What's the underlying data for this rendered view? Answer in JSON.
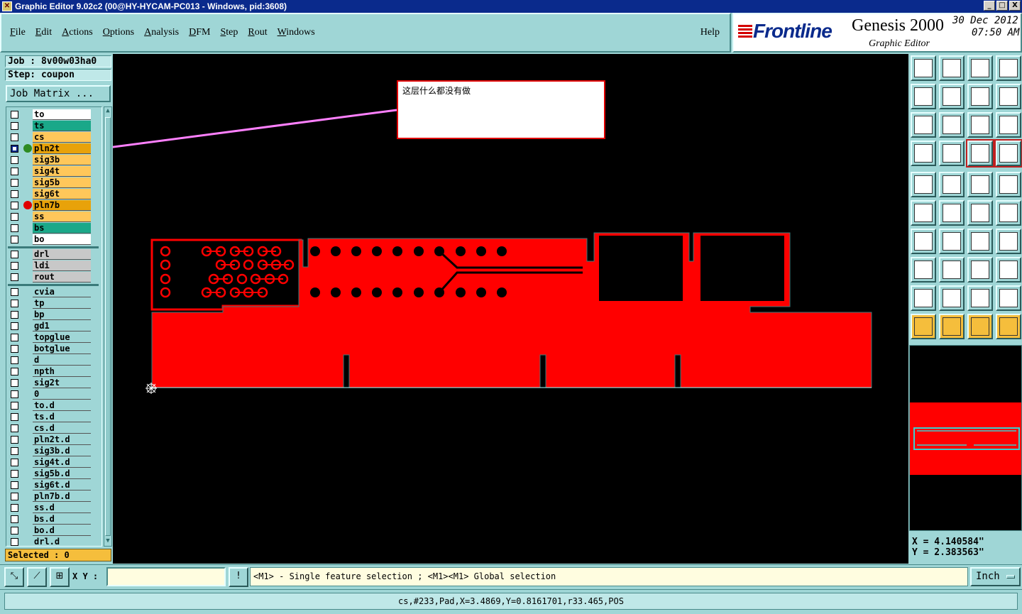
{
  "window": {
    "title": "Graphic Editor 9.02c2 (00@HY-HYCAM-PC013 - Windows, pid:3608)",
    "buttons": [
      "_",
      "□",
      "X"
    ]
  },
  "menu": {
    "items": [
      "File",
      "Edit",
      "Actions",
      "Options",
      "Analysis",
      "DFM",
      "Step",
      "Rout",
      "Windows"
    ],
    "help": "Help"
  },
  "brand": {
    "logo": "Frontline",
    "product": "Genesis 2000",
    "subtitle": "Graphic Editor",
    "date": "30 Dec 2012",
    "time": "07:50 AM"
  },
  "job": {
    "job_label": "Job : 8v00w03ha0",
    "step_label": "Step: coupon",
    "matrix_button": "Job Matrix ..."
  },
  "layers_board": [
    {
      "name": "to",
      "color": "#ffffff"
    },
    {
      "name": "ts",
      "color": "#1aa889"
    },
    {
      "name": "cs",
      "color": "#ffc75a"
    },
    {
      "name": "pln2t",
      "color": "#e8a20a",
      "active": true,
      "dot": "#2e8b22"
    },
    {
      "name": "sig3b",
      "color": "#ffc75a"
    },
    {
      "name": "sig4t",
      "color": "#ffc75a"
    },
    {
      "name": "sig5b",
      "color": "#ffc75a"
    },
    {
      "name": "sig6t",
      "color": "#ffc75a"
    },
    {
      "name": "pln7b",
      "color": "#e8a20a",
      "dot": "#e00000"
    },
    {
      "name": "ss",
      "color": "#ffc75a"
    },
    {
      "name": "bs",
      "color": "#1aa889"
    },
    {
      "name": "bo",
      "color": "#ffffff"
    }
  ],
  "layers_drill": [
    {
      "name": "drl",
      "color": "#c8c8c8"
    },
    {
      "name": "ldi",
      "color": "#c8c8c8"
    },
    {
      "name": "rout",
      "color": "#c8c8c8"
    }
  ],
  "layers_misc": [
    {
      "name": "cvia",
      "color": "#9fd6d6"
    },
    {
      "name": "tp",
      "color": "#9fd6d6"
    },
    {
      "name": "bp",
      "color": "#9fd6d6"
    },
    {
      "name": "gd1",
      "color": "#9fd6d6"
    },
    {
      "name": "topglue",
      "color": "#9fd6d6"
    },
    {
      "name": "botglue",
      "color": "#9fd6d6"
    },
    {
      "name": "d",
      "color": "#9fd6d6"
    },
    {
      "name": "npth",
      "color": "#9fd6d6"
    },
    {
      "name": "sig2t",
      "color": "#9fd6d6"
    },
    {
      "name": "0",
      "color": "#9fd6d6"
    },
    {
      "name": "to.d",
      "color": "#9fd6d6"
    },
    {
      "name": "ts.d",
      "color": "#9fd6d6"
    },
    {
      "name": "cs.d",
      "color": "#9fd6d6"
    },
    {
      "name": "pln2t.d",
      "color": "#9fd6d6"
    },
    {
      "name": "sig3b.d",
      "color": "#9fd6d6"
    },
    {
      "name": "sig4t.d",
      "color": "#9fd6d6"
    },
    {
      "name": "sig5b.d",
      "color": "#9fd6d6"
    },
    {
      "name": "sig6t.d",
      "color": "#9fd6d6"
    },
    {
      "name": "pln7b.d",
      "color": "#9fd6d6"
    },
    {
      "name": "ss.d",
      "color": "#9fd6d6"
    },
    {
      "name": "bs.d",
      "color": "#9fd6d6"
    },
    {
      "name": "bo.d",
      "color": "#9fd6d6"
    },
    {
      "name": "drl.d",
      "color": "#9fd6d6"
    }
  ],
  "selected_label": "Selected : 0",
  "annotation": {
    "text": "这层什么都没有做",
    "color": "#e00000",
    "arrow_color": "#ff80ff"
  },
  "feature_color": "#ff0000",
  "coords": {
    "x": "X = 4.140584\"",
    "y": "Y = 2.383563\""
  },
  "cmd": {
    "xy_label": "X Y :",
    "xy_value": "",
    "prompt": "<M1> - Single feature selection ; <M1><M1> Global selection",
    "units": "Inch",
    "excl": "!"
  },
  "status": "cs,#233,Pad,X=3.4869,Y=0.8161701,r33.465,POS"
}
